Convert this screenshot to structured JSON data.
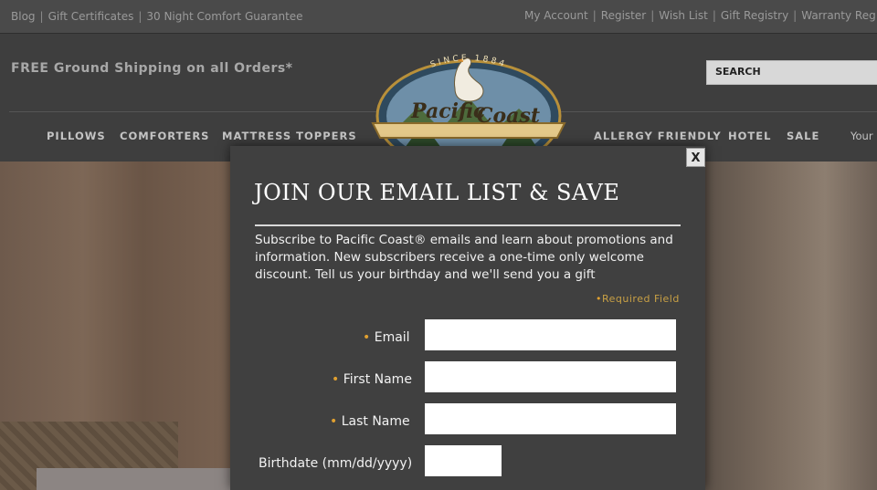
{
  "topbar": {
    "left_links": [
      "Blog",
      "Gift Certificates",
      "30 Night Comfort Guarantee"
    ],
    "right_links": [
      "My Account",
      "Register",
      "Wish List",
      "Gift Registry",
      "Warranty Reg"
    ]
  },
  "header": {
    "shipping_text": "FREE Ground Shipping on all Orders*",
    "search_placeholder": "SEARCH",
    "logo": {
      "arc_text": "SINCE 1884",
      "brand_line1": "Pacific",
      "brand_line2": "Coast"
    },
    "nav": {
      "pillows": "PILLOWS",
      "comforters": "COMFORTERS",
      "mattress_toppers": "MATTRESS TOPPERS",
      "allergy_friendly": "ALLERGY FRIENDLY",
      "hotel": "HOTEL",
      "sale": "SALE",
      "your": "Your"
    }
  },
  "modal": {
    "close_label": "X",
    "title": "JOIN OUR EMAIL LIST & SAVE",
    "description": "Subscribe to Pacific Coast® emails and learn about promotions and information. New subscribers receive a one-time only welcome discount. Tell us your birthday and we'll send you a gift",
    "required_bullet": "•",
    "required_note": "Required Field",
    "fields": {
      "email": {
        "label": "Email",
        "value": ""
      },
      "first_name": {
        "label": "First Name",
        "value": ""
      },
      "last_name": {
        "label": "Last Name",
        "value": ""
      },
      "birthdate": {
        "label": "Birthdate (mm/dd/yyyy)",
        "value": ""
      }
    }
  },
  "colors": {
    "accent_gold": "#e0a030",
    "modal_bg": "#404040",
    "page_bg": "#3c3c3c"
  }
}
